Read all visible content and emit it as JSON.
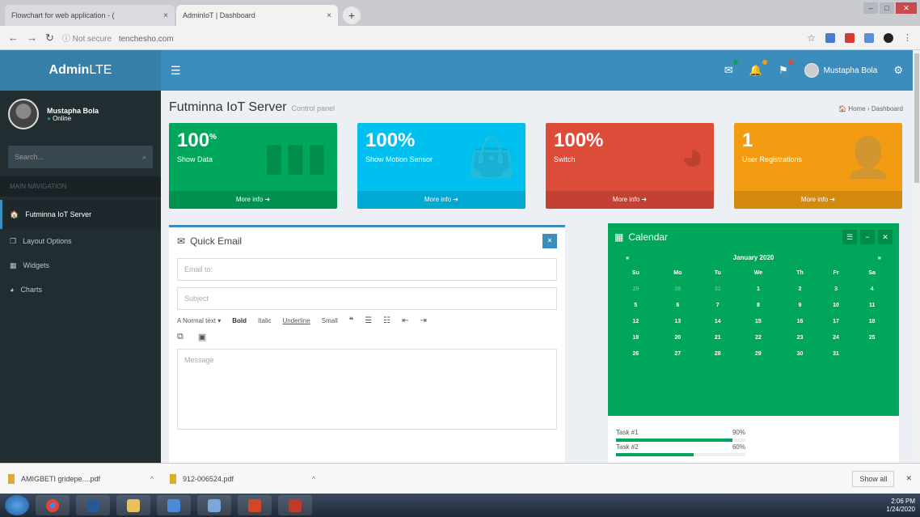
{
  "browser": {
    "tabs": [
      {
        "title": "Flowchart for web application - (",
        "close": "×"
      },
      {
        "title": "AdminIoT | Dashboard",
        "close": "×"
      }
    ],
    "new_tab": "+",
    "url_prefix": "ⓘ Not secure",
    "url": "tenchesho.com"
  },
  "app": {
    "logo_prefix": "Admin",
    "logo_suffix": "LTE",
    "user_name": "Mustapha Bola",
    "status": "Online",
    "search_placeholder": "Search...",
    "nav_header": "MAIN NAVIGATION",
    "menu": [
      {
        "label": "Futminna IoT Server",
        "icon": "🏠"
      },
      {
        "label": "Layout Options",
        "icon": "❐"
      },
      {
        "label": "Widgets",
        "icon": "▦"
      },
      {
        "label": "Charts",
        "icon": "◕"
      }
    ]
  },
  "page": {
    "title": "Futminna IoT Server",
    "subtitle": "Control panel",
    "breadcrumb": "🏠 Home › Dashboard"
  },
  "stats": [
    {
      "value": "100",
      "suffix": "%",
      "label": "Show Data",
      "more": "More info ➜",
      "icon": "▮▮▮"
    },
    {
      "value": "100%",
      "suffix": "",
      "label": "Show Motion Sensor",
      "more": "More info ➜",
      "icon": "👜"
    },
    {
      "value": "100%",
      "suffix": "",
      "label": "Switch",
      "more": "More info ➜",
      "icon": "◕"
    },
    {
      "value": "1",
      "suffix": "",
      "label": "User Registrations",
      "more": "More info ➜",
      "icon": "👤"
    }
  ],
  "email": {
    "title": "Quick Email",
    "to_placeholder": "Email to:",
    "subject_placeholder": "Subject",
    "toolbar": [
      "A Normal text ▾",
      "Bold",
      "Italic",
      "Underline",
      "Small",
      "❝",
      "☰",
      "☷",
      "⇤",
      "⇥"
    ],
    "message_placeholder": "Message"
  },
  "calendar": {
    "title": "Calendar",
    "month": "January 2020",
    "days": [
      "Su",
      "Mo",
      "Tu",
      "We",
      "Th",
      "Fr",
      "Sa"
    ],
    "weeks": [
      [
        "29",
        "30",
        "31",
        "1",
        "2",
        "3",
        "4"
      ],
      [
        "5",
        "6",
        "7",
        "8",
        "9",
        "10",
        "11"
      ],
      [
        "12",
        "13",
        "14",
        "15",
        "16",
        "17",
        "18"
      ],
      [
        "19",
        "20",
        "21",
        "22",
        "23",
        "24",
        "25"
      ],
      [
        "26",
        "27",
        "28",
        "29",
        "30",
        "31",
        ""
      ]
    ],
    "prev": "«",
    "next": "»"
  },
  "tasks": [
    {
      "label": "Task #1",
      "pct": "90%",
      "fill": 0.9
    },
    {
      "label": "Task #2",
      "pct": "60%",
      "fill": 0.6
    }
  ],
  "downloads": [
    {
      "name": "AMIGBETI gridepe....pdf"
    },
    {
      "name": "912-006524.pdf"
    }
  ],
  "downloads_showall": "Show all",
  "tray": {
    "time": "2:06 PM",
    "date": "1/24/2020"
  },
  "colors": {
    "green": "#00a65a",
    "aqua": "#00c0ef",
    "red": "#dd4b39",
    "yellow": "#f39c12",
    "primary": "#3c8dbc"
  }
}
